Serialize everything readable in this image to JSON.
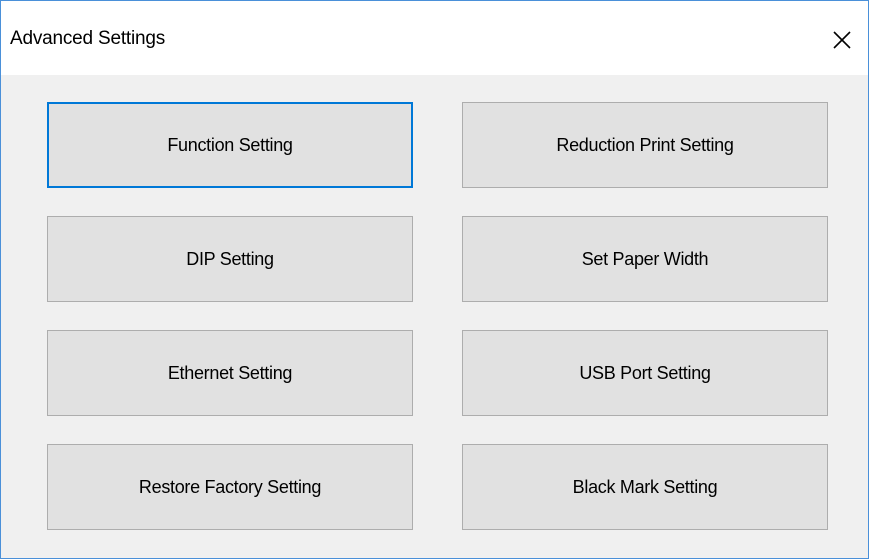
{
  "window": {
    "title": "Advanced Settings",
    "close_icon": "close-icon"
  },
  "buttons": {
    "function_setting": "Function Setting",
    "reduction_print_setting": "Reduction Print Setting",
    "dip_setting": "DIP Setting",
    "set_paper_width": "Set Paper Width",
    "ethernet_setting": "Ethernet Setting",
    "usb_port_setting": "USB Port Setting",
    "restore_factory_setting": "Restore Factory Setting",
    "black_mark_setting": "Black Mark Setting"
  },
  "colors": {
    "window_border": "#4a90d9",
    "focus_border": "#0078d7",
    "button_face": "#e1e1e1",
    "button_border": "#adadad",
    "client_background": "#f0f0f0"
  }
}
